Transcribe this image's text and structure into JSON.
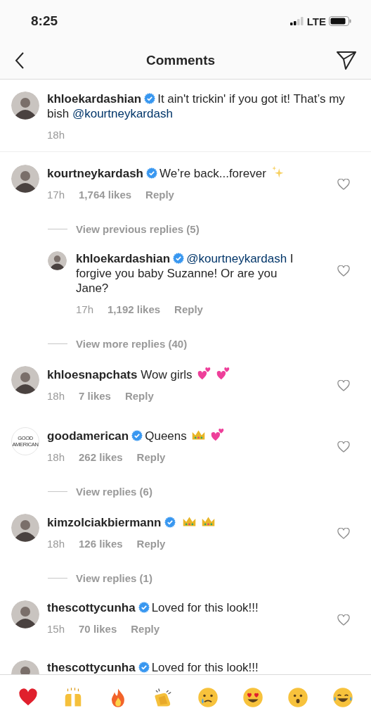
{
  "status_bar": {
    "time": "8:25",
    "network": "LTE"
  },
  "header": {
    "title": "Comments"
  },
  "caption": {
    "avatar": {
      "kind": "photo"
    },
    "user": "khloekardashian",
    "verified": true,
    "text": [
      {
        "kind": "plain",
        "text": "It ain't trickin' if you got it! That’s my bish "
      },
      {
        "kind": "mention",
        "text": "@kourtneykardash"
      }
    ],
    "time": "18h"
  },
  "comments": [
    {
      "kind": "comment",
      "avatar": {
        "kind": "photo"
      },
      "user": "kourtneykardash",
      "verified": true,
      "text": [
        {
          "kind": "plain",
          "text": "We’re back...forever"
        }
      ],
      "emojis": [
        {
          "kind": "sparkles"
        }
      ],
      "time": "17h",
      "likes": "1,764 likes",
      "reply_label": "Reply",
      "liked": false,
      "children": [
        {
          "kind": "replies_link",
          "label": "View previous replies (5)"
        },
        {
          "kind": "comment",
          "avatar": {
            "kind": "photo"
          },
          "user": "khloekardashian",
          "verified": true,
          "text": [
            {
              "kind": "mention",
              "text": "@kourtneykardash"
            },
            {
              "kind": "plain",
              "text": " I forgive you baby Suzanne! Or are you Jane?"
            }
          ],
          "time": "17h",
          "likes": "1,192 likes",
          "reply_label": "Reply",
          "liked": false
        },
        {
          "kind": "replies_link",
          "label": "View more replies (40)"
        }
      ]
    },
    {
      "kind": "comment",
      "avatar": {
        "kind": "photo"
      },
      "user": "khloesnapchats",
      "verified": false,
      "text": [
        {
          "kind": "plain",
          "text": "Wow girls"
        }
      ],
      "emojis": [
        {
          "kind": "two_hearts"
        },
        {
          "kind": "two_hearts"
        }
      ],
      "time": "18h",
      "likes": "7 likes",
      "reply_label": "Reply",
      "liked": false
    },
    {
      "kind": "comment",
      "avatar": {
        "kind": "logo",
        "lines": [
          "GOOD",
          "AMERICAN"
        ]
      },
      "user": "goodamerican",
      "verified": true,
      "text": [
        {
          "kind": "plain",
          "text": "Queens"
        }
      ],
      "emojis": [
        {
          "kind": "crown"
        },
        {
          "kind": "two_hearts"
        }
      ],
      "time": "18h",
      "likes": "262 likes",
      "reply_label": "Reply",
      "liked": false
    },
    {
      "kind": "replies_link",
      "label": "View replies (6)"
    },
    {
      "kind": "comment",
      "avatar": {
        "kind": "photo"
      },
      "user": "kimzolciakbiermann",
      "verified": true,
      "emojis": [
        {
          "kind": "crown"
        },
        {
          "kind": "crown"
        }
      ],
      "time": "18h",
      "likes": "126 likes",
      "reply_label": "Reply",
      "liked": false
    },
    {
      "kind": "replies_link",
      "label": "View replies (1)"
    },
    {
      "kind": "comment",
      "avatar": {
        "kind": "photo"
      },
      "user": "thescottycunha",
      "verified": true,
      "text": [
        {
          "kind": "plain",
          "text": "Loved for this look!!!"
        }
      ],
      "time": "15h",
      "likes": "70 likes",
      "reply_label": "Reply",
      "liked": false
    },
    {
      "kind": "comment",
      "avatar": {
        "kind": "photo"
      },
      "user": "thescottycunha",
      "verified": true,
      "text": [
        {
          "kind": "plain",
          "text": "Loved for this look!!!"
        }
      ]
    }
  ],
  "emoji_bar": [
    {
      "kind": "heart"
    },
    {
      "kind": "raised_hands"
    },
    {
      "kind": "fire"
    },
    {
      "kind": "clap"
    },
    {
      "kind": "crying"
    },
    {
      "kind": "heart_eyes"
    },
    {
      "kind": "surprised"
    },
    {
      "kind": "joy"
    }
  ]
}
